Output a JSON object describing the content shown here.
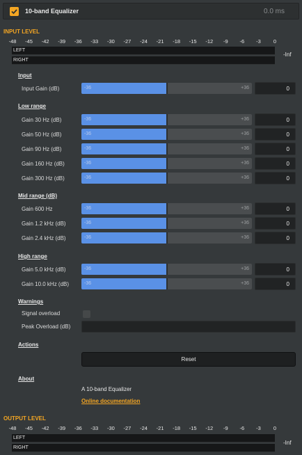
{
  "header": {
    "enabled": true,
    "title": "10-band Equalizer",
    "time": "0.0 ms"
  },
  "input_level": {
    "title": "INPUT LEVEL",
    "scale": [
      "-48",
      "-45",
      "-42",
      "-39",
      "-36",
      "-33",
      "-30",
      "-27",
      "-24",
      "-21",
      "-18",
      "-15",
      "-12",
      "-9",
      "-6",
      "-3",
      "0"
    ],
    "left_label": "LEFT",
    "right_label": "RIGHT",
    "peak": "-Inf"
  },
  "sections": {
    "input": "Input",
    "low_range": "Low range",
    "mid_range": "Mid range (dB)",
    "high_range": "High range",
    "warnings": "Warnings",
    "actions": "Actions",
    "about": "About"
  },
  "slider_min": "-36",
  "slider_max": "+36",
  "sliders": [
    {
      "label": "Input Gain (dB)",
      "value": "0"
    },
    {
      "label": "Gain 30 Hz (dB)",
      "value": "0"
    },
    {
      "label": "Gain 50 Hz (dB)",
      "value": "0"
    },
    {
      "label": "Gain 90 Hz (dB)",
      "value": "0"
    },
    {
      "label": "Gain 160 Hz (dB)",
      "value": "0"
    },
    {
      "label": "Gain 300 Hz (dB)",
      "value": "0"
    },
    {
      "label": "Gain 600 Hz",
      "value": "0"
    },
    {
      "label": "Gain 1.2 kHz (dB)",
      "value": "0"
    },
    {
      "label": "Gain 2.4 kHz (dB)",
      "value": "0"
    },
    {
      "label": "Gain 5.0 kHz (dB)",
      "value": "0"
    },
    {
      "label": "Gain 10.0 kHz (dB)",
      "value": "0"
    }
  ],
  "slider_fraction": 0.5,
  "warnings": {
    "signal_overload_label": "Signal overload",
    "signal_overload_checked": false,
    "peak_overload_label": "Peak Overload (dB)",
    "peak_overload_value": ""
  },
  "actions": {
    "reset_label": "Reset"
  },
  "about": {
    "text": "A 10-band Equalizer",
    "link": "Online documentation"
  },
  "output_level": {
    "title": "OUTPUT LEVEL",
    "scale": [
      "-48",
      "-45",
      "-42",
      "-39",
      "-36",
      "-33",
      "-30",
      "-27",
      "-24",
      "-21",
      "-18",
      "-15",
      "-12",
      "-9",
      "-6",
      "-3",
      "0"
    ],
    "left_label": "LEFT",
    "right_label": "RIGHT",
    "peak": "-Inf"
  },
  "colors": {
    "accent": "#f4a623",
    "slider_fill": "#5a91e6",
    "background": "#35393b"
  }
}
